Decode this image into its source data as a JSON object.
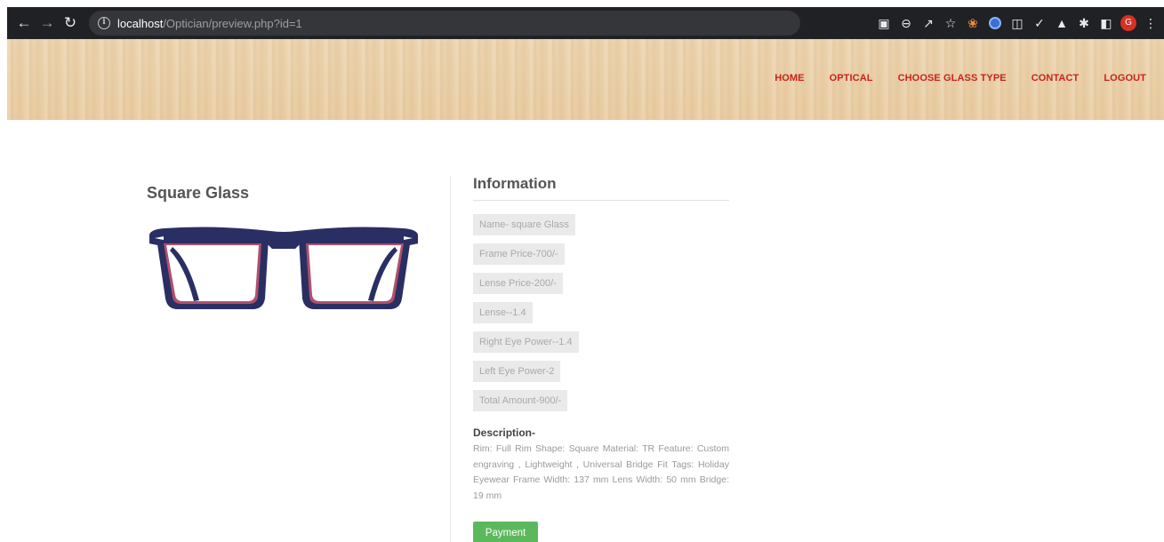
{
  "browser": {
    "url_host": "localhost",
    "url_path": "/Optician/preview.php?id=1",
    "avatar_letter": "G"
  },
  "nav": {
    "home": "HOME",
    "optical": "OPTICAL",
    "choose_glass_type": "CHOOSE GLASS TYPE",
    "contact": "CONTACT",
    "logout": "LOGOUT"
  },
  "product": {
    "title": "Square Glass"
  },
  "information": {
    "heading": "Information",
    "items": [
      "Name- square Glass",
      "Frame Price-700/-",
      "Lense Price-200/-",
      "Lense--1.4",
      "Right Eye Power--1.4",
      "Left Eye Power-2",
      "Total Amount-900/-"
    ],
    "description_heading": "Description-",
    "description": "Rim: Full Rim Shape: Square Material: TR Feature: Custom engraving , Lightweight , Universal Bridge Fit Tags: Holiday Eyewear Frame Width: 137 mm Lens Width: 50 mm Bridge: 19 mm",
    "payment_label": "Payment"
  },
  "colors": {
    "nav_link": "#c8241d",
    "payment_button": "#5cb85c",
    "frame": "#2a2f63",
    "frame_inner": "#b0506a"
  }
}
